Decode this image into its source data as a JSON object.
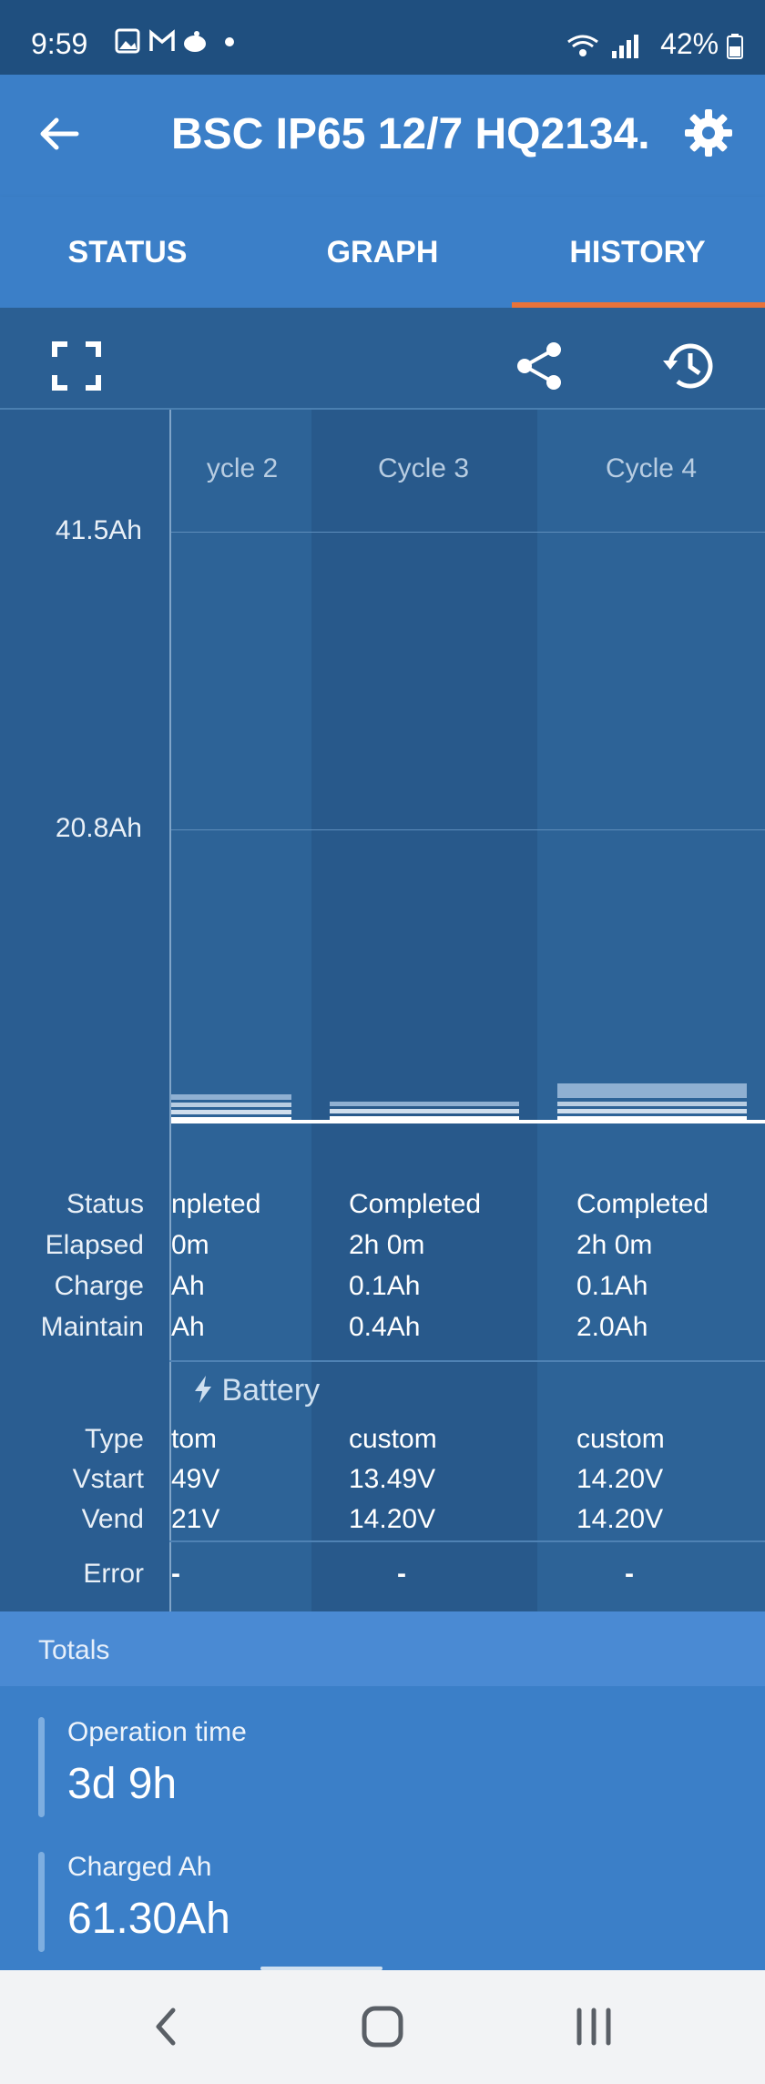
{
  "status_bar": {
    "time": "9:59",
    "notification_icons": [
      "image-icon",
      "gmail-icon",
      "app-icon",
      "dot"
    ],
    "battery_percent": "42%"
  },
  "app_bar": {
    "title": "BSC IP65 12/7 HQ2134."
  },
  "tabs": [
    {
      "label": "STATUS"
    },
    {
      "label": "GRAPH"
    },
    {
      "label": "HISTORY",
      "selected": true
    }
  ],
  "chart": {
    "y_ticks": [
      "41.5Ah",
      "20.8Ah"
    ],
    "cycles": [
      {
        "name": "ycle 2",
        "status": "npleted",
        "elapsed": "0m",
        "charge": "Ah",
        "maintain": "Ah",
        "type": "tom",
        "vstart": "49V",
        "vend": "21V",
        "error": "-"
      },
      {
        "name": "Cycle 3",
        "status": "Completed",
        "elapsed": "2h 0m",
        "charge": "0.1Ah",
        "maintain": "0.4Ah",
        "type": "custom",
        "vstart": "13.49V",
        "vend": "14.20V",
        "error": "-"
      },
      {
        "name": "Cycle 4",
        "status": "Completed",
        "elapsed": "2h 0m",
        "charge": "0.1Ah",
        "maintain": "2.0Ah",
        "type": "custom",
        "vstart": "14.20V",
        "vend": "14.20V",
        "error": "-"
      }
    ],
    "row_labels": {
      "status": "Status",
      "elapsed": "Elapsed",
      "charge": "Charge",
      "maintain": "Maintain",
      "battery_header": "Battery",
      "type": "Type",
      "vstart": "Vstart",
      "vend": "Vend",
      "error": "Error"
    }
  },
  "totals": {
    "header": "Totals",
    "items": [
      {
        "label": "Operation time",
        "value": "3d 9h"
      },
      {
        "label": "Charged Ah",
        "value": "61.30Ah"
      }
    ]
  },
  "colors": {
    "accent_tab_underline": "#e8733a",
    "app_bar": "#3b7fc8",
    "background": "#2b5f93"
  }
}
